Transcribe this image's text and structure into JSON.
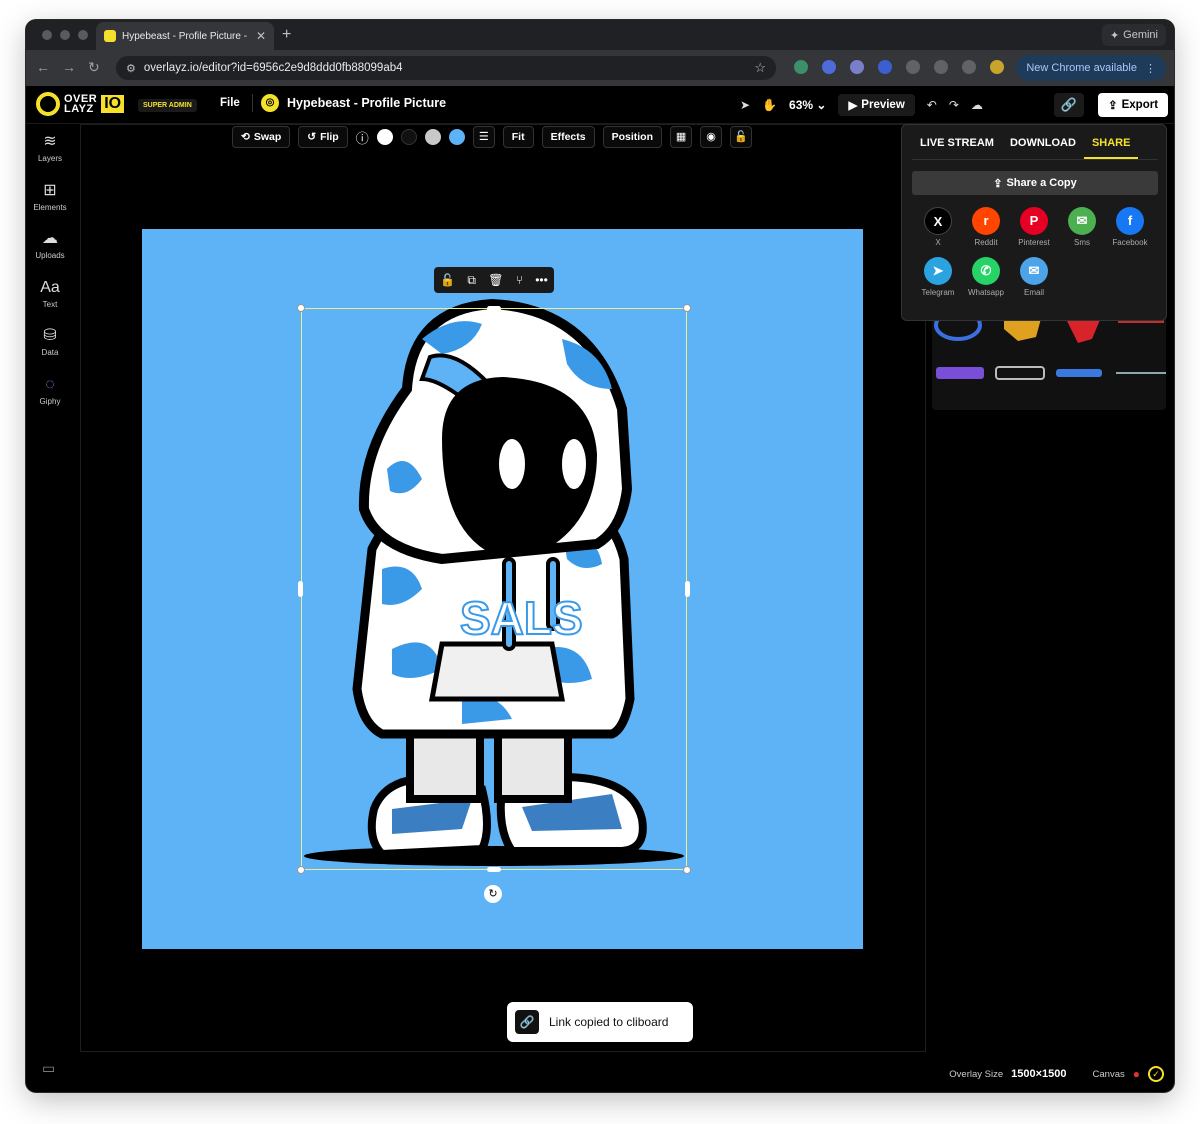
{
  "browser": {
    "tab_title": "Hypebeast - Profile Picture -",
    "url": "overlayz.io/editor?id=6956c2e9d8ddd0fb88099ab4",
    "gemini_label": "Gemini",
    "update_label": "New Chrome available"
  },
  "header": {
    "logo_text_top": "OVER",
    "logo_text_bottom": "LAYZ",
    "logo_io": "IO",
    "role_badge": "SUPER ADMIN",
    "file_menu": "File",
    "project_title": "Hypebeast - Profile Picture",
    "zoom": "63%",
    "preview_label": "Preview",
    "export_label": "Export"
  },
  "sidebar": {
    "items": [
      {
        "label": "Layers",
        "icon": "layers-icon"
      },
      {
        "label": "Elements",
        "icon": "elements-icon"
      },
      {
        "label": "Uploads",
        "icon": "upload-cloud-icon"
      },
      {
        "label": "Text",
        "icon": "text-icon"
      },
      {
        "label": "Data",
        "icon": "data-icon"
      },
      {
        "label": "Giphy",
        "icon": "giphy-icon"
      }
    ]
  },
  "toolbar": {
    "swap": "Swap",
    "flip": "Flip",
    "fit": "Fit",
    "effects": "Effects",
    "position": "Position",
    "swatches": [
      "#ffffff",
      "#111111",
      "#c8c8c8",
      "#5db3f6"
    ]
  },
  "canvas": {
    "background": "#5db3f6",
    "character_text": "SALS"
  },
  "share": {
    "tabs": [
      "LIVE STREAM",
      "DOWNLOAD",
      "SHARE"
    ],
    "active_tab": "SHARE",
    "share_copy": "Share a Copy",
    "targets": [
      {
        "label": "X",
        "color": "#000000",
        "glyph": "X"
      },
      {
        "label": "Reddit",
        "color": "#ff4500",
        "glyph": "r"
      },
      {
        "label": "Pinterest",
        "color": "#e60023",
        "glyph": "P"
      },
      {
        "label": "Sms",
        "color": "#4caf50",
        "glyph": "✉"
      },
      {
        "label": "Facebook",
        "color": "#1877f2",
        "glyph": "f"
      },
      {
        "label": "Telegram",
        "color": "#2aa3e0",
        "glyph": "➤"
      },
      {
        "label": "Whatsapp",
        "color": "#25d366",
        "glyph": "✆"
      },
      {
        "label": "Email",
        "color": "#4da3e8",
        "glyph": "✉"
      }
    ]
  },
  "toast": {
    "message": "Link copied to cliboard"
  },
  "status": {
    "overlay_size_label": "Overlay Size",
    "overlay_size_value": "1500×1500",
    "canvas_label": "Canvas"
  }
}
